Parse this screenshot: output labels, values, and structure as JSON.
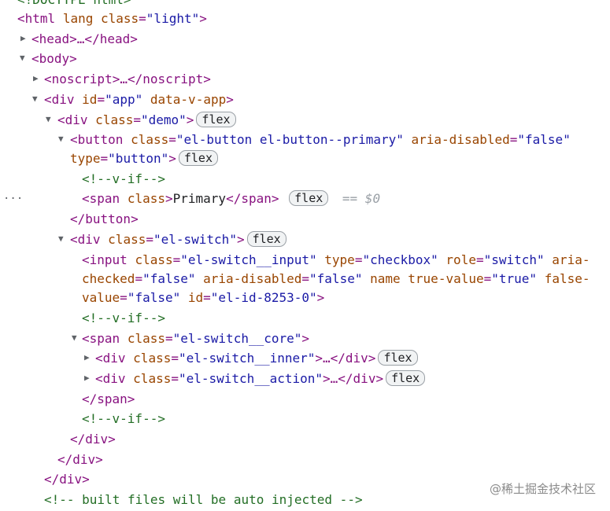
{
  "lines": {
    "doctype": "<!DOCTYPE html>",
    "html_open": "<html",
    "html_lang": "lang",
    "html_class_attr": "class",
    "html_class_val": "\"light\"",
    "html_close": ">",
    "head": "<head>…</head>",
    "body_open": "<body>",
    "noscript": "<noscript>…</noscript>",
    "app_div": "<div",
    "app_id_attr": "id",
    "app_id_val": "\"app\"",
    "app_vapp": "data-v-app",
    "demo_div": "<div",
    "demo_class_attr": "class",
    "demo_class_val": "\"demo\"",
    "button_open": "<button",
    "button_class_attr": "class",
    "button_class_val": "\"el-button el-button--primary\"",
    "button_aria_attr": "aria-disabled",
    "button_aria_val": "\"false\"",
    "button_type_attr": "type",
    "button_type_val": "\"button\"",
    "comment_vif": "<!--v-if-->",
    "span_open": "<span",
    "span_class": "class",
    "span_text": "Primary",
    "span_close": "</span>",
    "dollar": "== $0",
    "button_close": "</button>",
    "switch_div": "<div",
    "switch_class_attr": "class",
    "switch_class_val": "\"el-switch\"",
    "input_open": "<input",
    "input_class_attr": "class",
    "input_class_val": "\"el-switch__input\"",
    "input_type_attr": "type",
    "input_type_val": "\"checkbox\"",
    "input_role_attr": "role",
    "input_role_val": "\"switch\"",
    "input_aria_attr1": "aria-",
    "input_aria_attr2": "checked",
    "input_aria_val": "\"false\"",
    "input_ariad_attr": "aria-disabled",
    "input_ariad_val": "\"false\"",
    "input_name_attr": "name",
    "input_true_attr": "true-value",
    "input_true_val": "\"true\"",
    "input_false_attr1": "false-",
    "input_false_attr2": "value",
    "input_false_val": "\"false\"",
    "input_id_attr": "id",
    "input_id_val": "\"el-id-8253-0\"",
    "core_span": "<span",
    "core_class_attr": "class",
    "core_class_val": "\"el-switch__core\"",
    "inner_div": "<div",
    "inner_class_attr": "class",
    "inner_class_val": "\"el-switch__inner\"",
    "action_div": "<div",
    "action_class_attr": "class",
    "action_class_val": "\"el-switch__action\"",
    "collapsed_close_div": ">…</div>",
    "span_end": "</span>",
    "div_end": "</div>",
    "built_comment": "<!-- built files will be auto injected -->",
    "gt": ">"
  },
  "badge_label": "flex",
  "ellipsis": "…",
  "watermark": "@稀土掘金技术社区",
  "selected_line": "span Primary"
}
